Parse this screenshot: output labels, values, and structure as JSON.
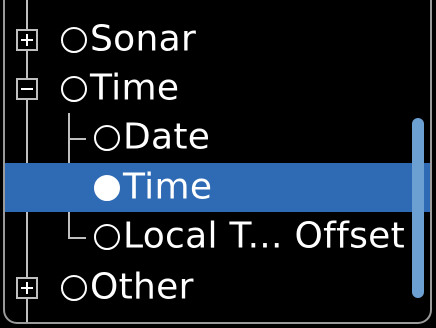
{
  "tree": {
    "items": [
      {
        "label": "Sonar",
        "level": 0,
        "expander": "plus",
        "selected": false
      },
      {
        "label": "Time",
        "level": 0,
        "expander": "minus",
        "selected": false
      },
      {
        "label": "Date",
        "level": 1,
        "selected": false
      },
      {
        "label": "Time",
        "level": 1,
        "selected": true
      },
      {
        "label": "Local T... Offset",
        "level": 1,
        "selected": false
      },
      {
        "label": "Other",
        "level": 0,
        "expander": "plus",
        "selected": false
      }
    ]
  },
  "colors": {
    "selected_row": "#2f6bb5",
    "scrollbar": "#6c9fd2",
    "background": "#000000",
    "text": "#ffffff"
  },
  "icons": {
    "expander_plus": "plus-box-icon",
    "expander_minus": "minus-box-icon",
    "radio_empty": "radio-empty-icon",
    "radio_filled": "radio-filled-icon"
  }
}
